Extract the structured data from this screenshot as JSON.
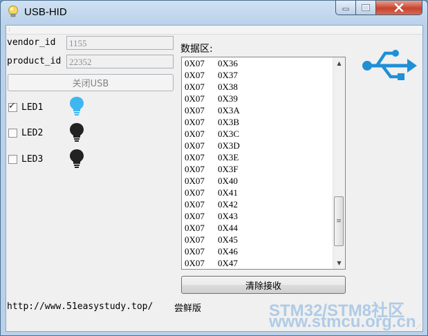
{
  "window": {
    "title": "USB-HID",
    "minimize_glyph": "—",
    "maximize_glyph": "□",
    "close_glyph": "✕"
  },
  "menustrip": {
    "grip": ":"
  },
  "fields": {
    "vendor_label": "vendor_id",
    "vendor_value": "1155",
    "product_label": "product_id",
    "product_value": "22352"
  },
  "buttons": {
    "close_usb": "关闭USB",
    "clear_receive": "清除接收"
  },
  "leds": [
    {
      "label": "LED1",
      "checked": true,
      "color": "#3fb6f0"
    },
    {
      "label": "LED2",
      "checked": false,
      "color": "#222222"
    },
    {
      "label": "LED3",
      "checked": false,
      "color": "#222222"
    }
  ],
  "data_area": {
    "label": "数据区:",
    "rows": [
      [
        "0X07",
        "0X36"
      ],
      [
        "0X07",
        "0X37"
      ],
      [
        "0X07",
        "0X38"
      ],
      [
        "0X07",
        "0X39"
      ],
      [
        "0X07",
        "0X3A"
      ],
      [
        "0X07",
        "0X3B"
      ],
      [
        "0X07",
        "0X3C"
      ],
      [
        "0X07",
        "0X3D"
      ],
      [
        "0X07",
        "0X3E"
      ],
      [
        "0X07",
        "0X3F"
      ],
      [
        "0X07",
        "0X40"
      ],
      [
        "0X07",
        "0X41"
      ],
      [
        "0X07",
        "0X42"
      ],
      [
        "0X07",
        "0X43"
      ],
      [
        "0X07",
        "0X44"
      ],
      [
        "0X07",
        "0X45"
      ],
      [
        "0X07",
        "0X46"
      ],
      [
        "0X07",
        "0X47"
      ]
    ],
    "scroll_position": 0.92
  },
  "footer": {
    "url": "http://www.51easystudy.top/",
    "version": "尝鲜版"
  },
  "watermark": {
    "line1": "STM32/STM8社区",
    "line2": "www.stmcu.org.cn"
  },
  "colors": {
    "usb_icon": "#1f8fd6",
    "led_on": "#3fb6f0",
    "led_off": "#222222"
  }
}
